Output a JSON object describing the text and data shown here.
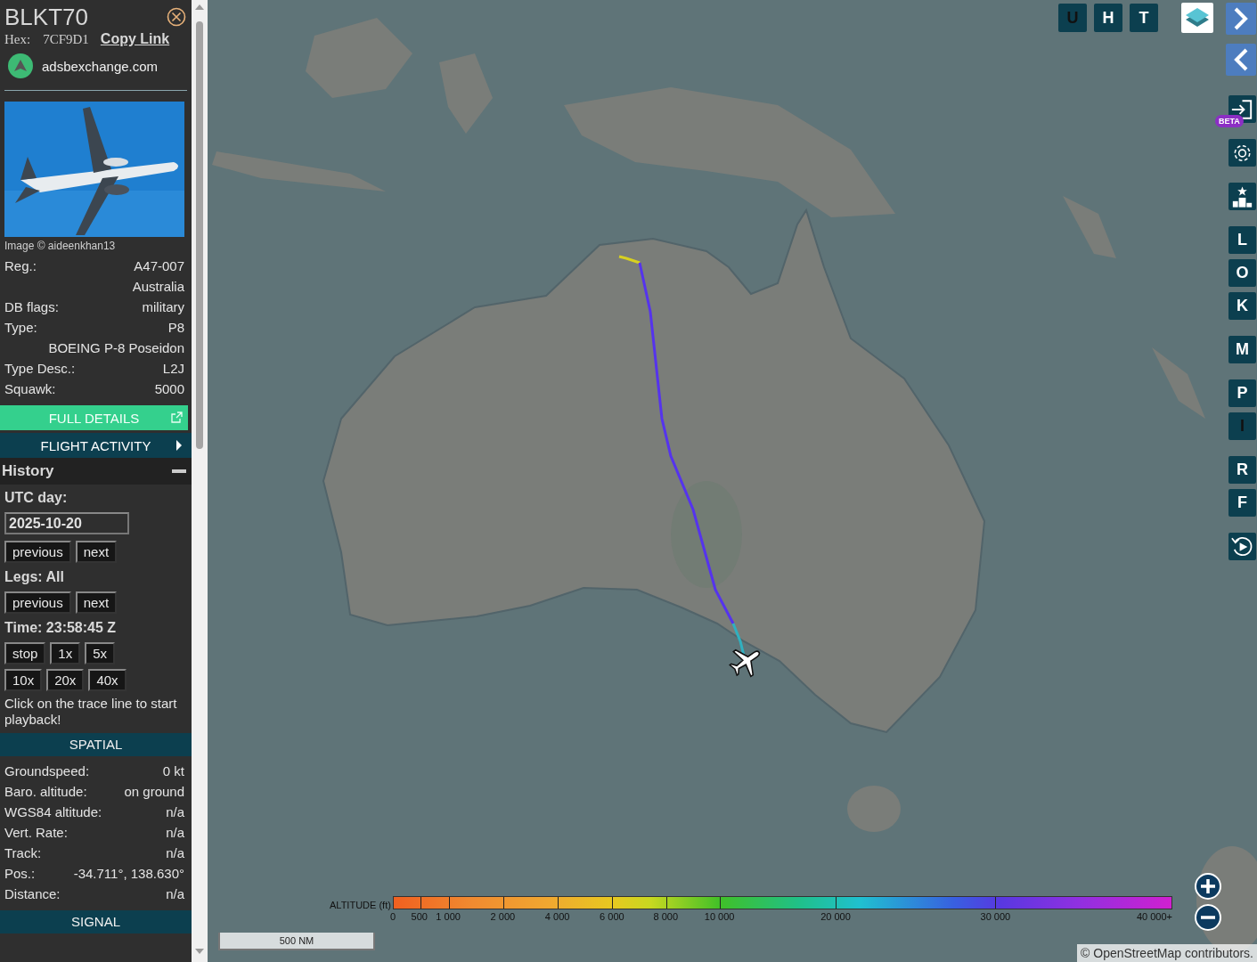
{
  "aircraft": {
    "callsign": "BLKT70",
    "hex_label": "Hex:",
    "hex": "7CF9D1",
    "copy_link": "Copy Link",
    "site": "adsbexchange.com",
    "photo": {
      "kind": "picture"
    },
    "photo_credit": "Image © aideenkhan13"
  },
  "details": [
    {
      "label": "Reg.:",
      "values": [
        "A47-007",
        "Australia"
      ]
    },
    {
      "label": "DB flags:",
      "values": [
        "military"
      ]
    },
    {
      "label": "Type:",
      "values": [
        "P8",
        "BOEING P-8 Poseidon"
      ]
    },
    {
      "label": "Type Desc.:",
      "values": [
        "L2J"
      ]
    },
    {
      "label": "Squawk:",
      "values": [
        "5000"
      ]
    }
  ],
  "full_details": "FULL DETAILS",
  "flight_activity": "FLIGHT ACTIVITY",
  "history": {
    "title": "History",
    "utc_label": "UTC day:",
    "date": "2025-10-20",
    "day_buttons": [
      "previous",
      "next"
    ],
    "legs_label": "Legs: All",
    "leg_buttons": [
      "previous",
      "next"
    ],
    "time": "Time: 23:58:45 Z",
    "speed_rows": [
      [
        "stop",
        "1x",
        "5x"
      ],
      [
        "10x",
        "20x",
        "40x"
      ]
    ],
    "hint": "Click on the trace line to start playback!"
  },
  "spatial": {
    "title": "SPATIAL",
    "rows": [
      {
        "label": "Groundspeed:",
        "value": "0 kt"
      },
      {
        "label": "Baro. altitude:",
        "value": "on ground"
      },
      {
        "label": "WGS84 altitude:",
        "value": "n/a"
      },
      {
        "label": "Vert. Rate:",
        "value": "n/a"
      },
      {
        "label": "Track:",
        "value": "n/a"
      },
      {
        "label": "Pos.:",
        "value": "-34.711°, 138.630°"
      },
      {
        "label": "Distance:",
        "value": "n/a"
      }
    ]
  },
  "signal": {
    "title": "SIGNAL"
  },
  "map": {
    "picture": {
      "kind": "picture"
    },
    "top_buttons": [
      {
        "label": "U",
        "on": false
      },
      {
        "label": "H",
        "on": true
      },
      {
        "label": "T",
        "on": true
      }
    ],
    "side_groups": [
      [
        {
          "kind": "panel"
        },
        {
          "kind": "panel"
        }
      ],
      [
        {
          "kind": "icon",
          "badge": "BETA"
        }
      ],
      [
        {
          "kind": "icon"
        }
      ],
      [
        {
          "kind": "icon"
        }
      ],
      [
        {
          "kind": "letter",
          "label": "L",
          "on": true
        },
        {
          "kind": "letter",
          "label": "O",
          "on": true
        },
        {
          "kind": "letter",
          "label": "K",
          "on": true
        }
      ],
      [
        {
          "kind": "letter",
          "label": "M",
          "on": true
        }
      ],
      [
        {
          "kind": "letter",
          "label": "P",
          "on": true
        },
        {
          "kind": "letter",
          "label": "I",
          "on": false
        }
      ],
      [
        {
          "kind": "letter",
          "label": "R",
          "on": true
        },
        {
          "kind": "letter",
          "label": "F",
          "on": true
        }
      ],
      [
        {
          "kind": "icon"
        }
      ]
    ],
    "legend": {
      "title": "ALTITUDE (ft)",
      "ticks": [
        "0",
        "500",
        "1 000",
        "2 000",
        "4 000",
        "6 000",
        "8 000",
        "10 000",
        "20 000",
        "30 000",
        "40 000+"
      ]
    },
    "scale": "500 NM",
    "attribution": "© OpenStreetMap contributors."
  }
}
